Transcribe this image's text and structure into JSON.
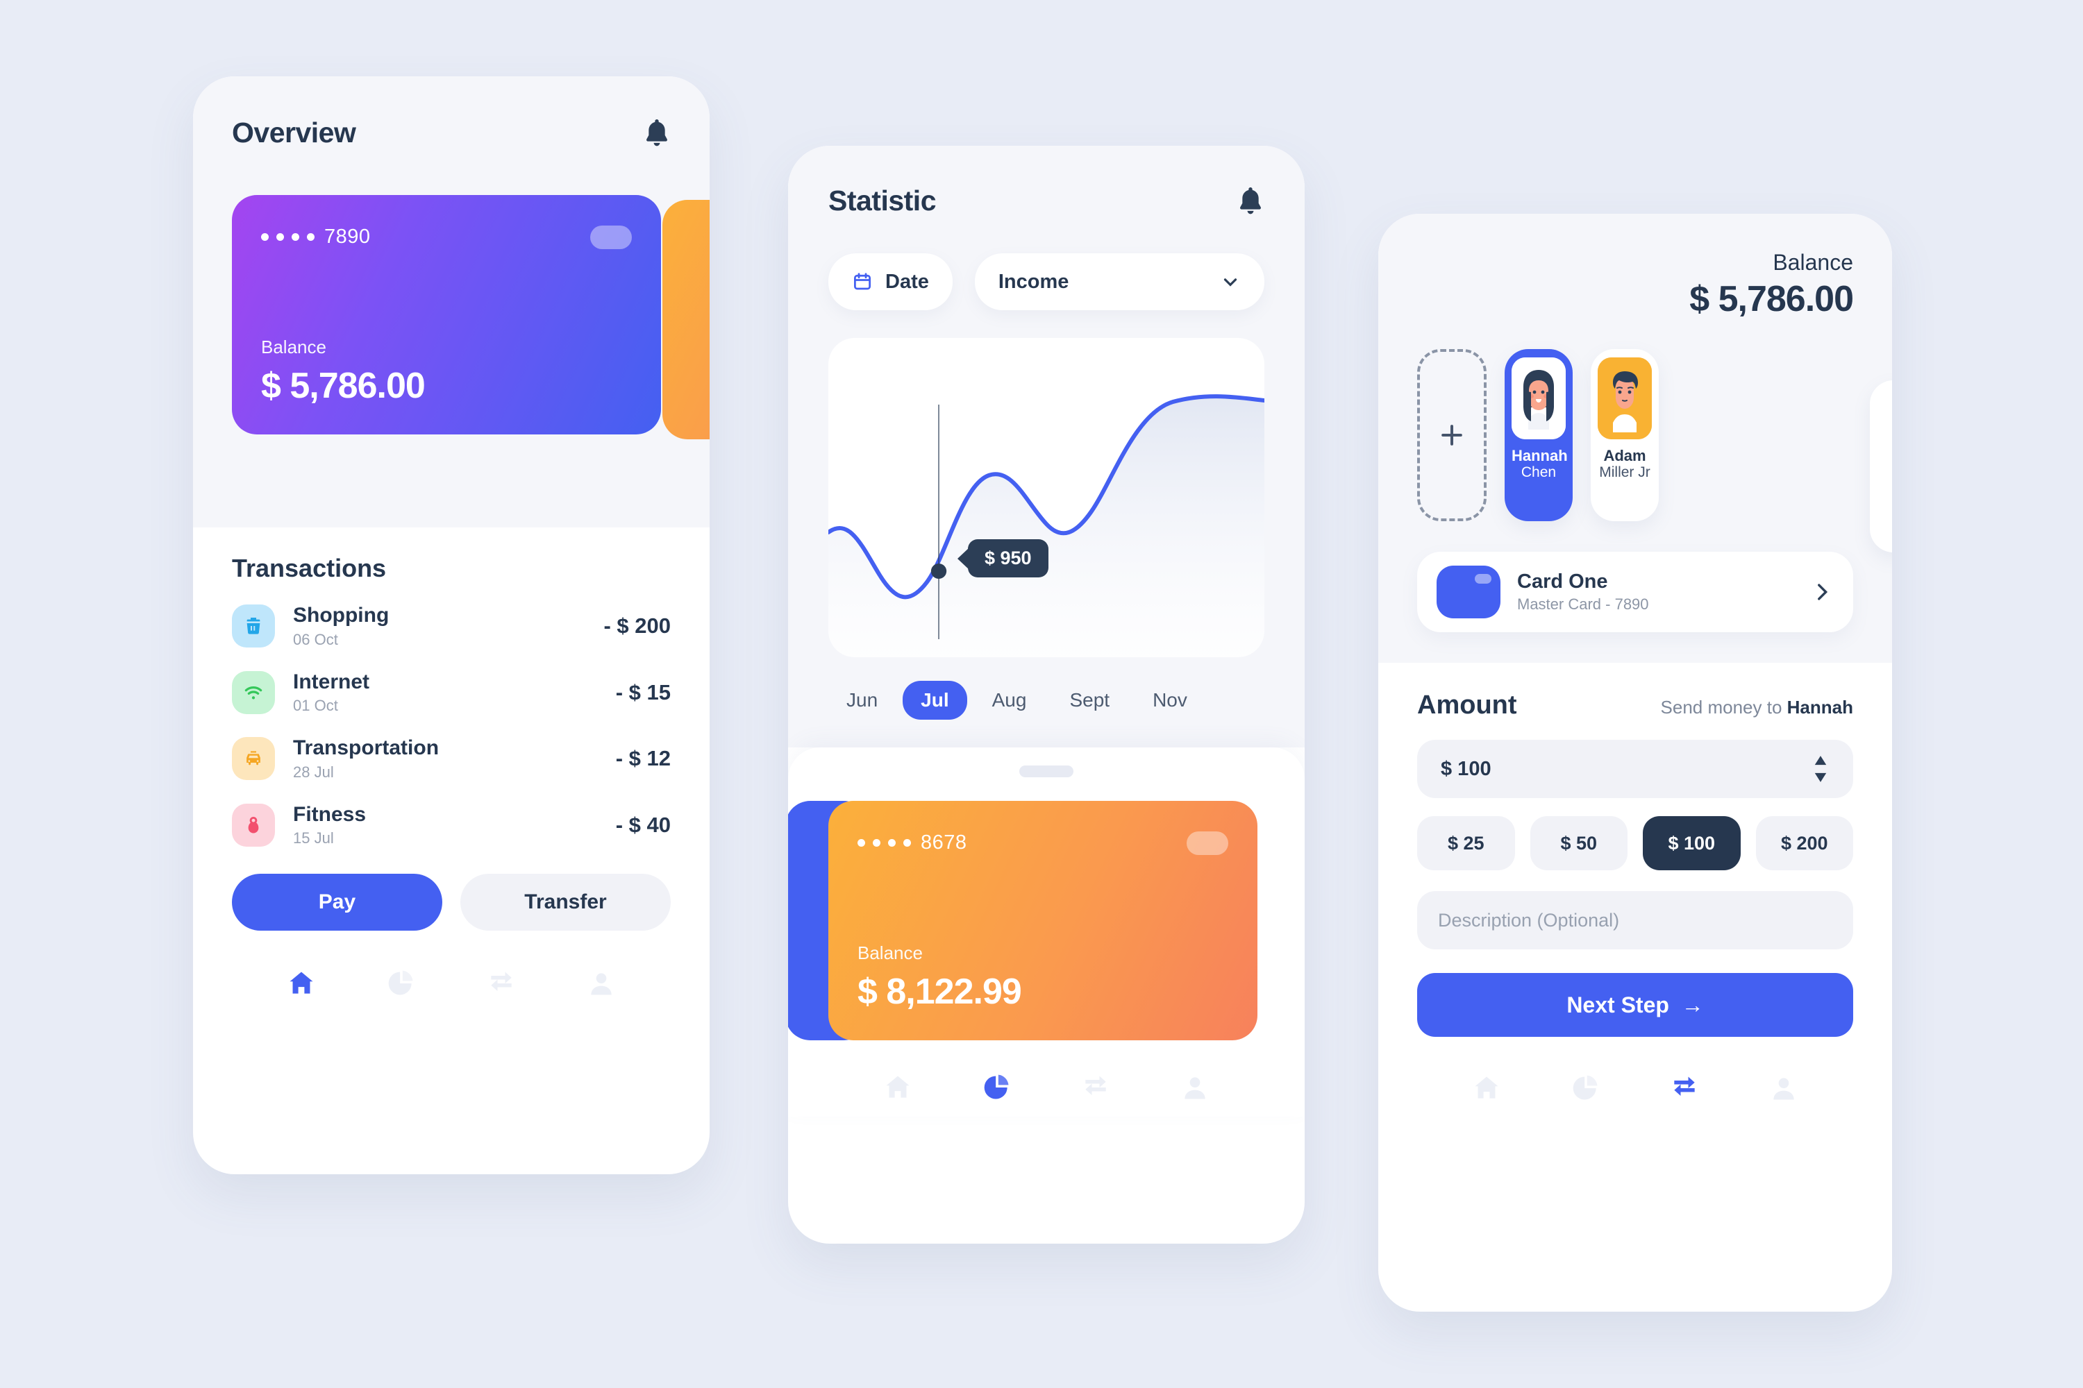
{
  "screen_overview": {
    "title": "Overview",
    "bell_icon": "bell-icon",
    "card": {
      "masked_dots": "••••",
      "last4": "7890",
      "balance_label": "Balance",
      "balance_value": "$ 5,786.00",
      "gradient_from": "#a445f0",
      "gradient_to": "#4460f1"
    },
    "peek_card_color": "#fbb03b",
    "transactions_title": "Transactions",
    "transactions": [
      {
        "name": "Shopping",
        "date": "06 Oct",
        "amount": "- $ 200",
        "icon": "basket-icon",
        "icon_bg": "#bfe6fb",
        "icon_fg": "#23a6e8"
      },
      {
        "name": "Internet",
        "date": "01 Oct",
        "amount": "- $ 15",
        "icon": "wifi-icon",
        "icon_bg": "#c6f3d4",
        "icon_fg": "#34c759"
      },
      {
        "name": "Transportation",
        "date": "28 Jul",
        "amount": "- $ 12",
        "icon": "taxi-icon",
        "icon_bg": "#fde6bc",
        "icon_fg": "#f5a623"
      },
      {
        "name": "Fitness",
        "date": "15 Jul",
        "amount": "- $ 40",
        "icon": "kettlebell-icon",
        "icon_bg": "#fcd3dc",
        "icon_fg": "#f2506e"
      }
    ],
    "pay_label": "Pay",
    "transfer_label": "Transfer",
    "nav": [
      {
        "icon": "home-icon",
        "active": true
      },
      {
        "icon": "pie-icon",
        "active": false
      },
      {
        "icon": "exchange-icon",
        "active": false
      },
      {
        "icon": "person-icon",
        "active": false
      }
    ]
  },
  "screen_statistic": {
    "title": "Statistic",
    "bell_icon": "bell-icon",
    "date_pill": {
      "label": "Date",
      "icon": "calendar-icon"
    },
    "type_select": {
      "value": "Income",
      "icon": "chevron-down-icon"
    },
    "months": [
      "Jun",
      "Jul",
      "Aug",
      "Sept",
      "Nov"
    ],
    "active_month": "Jul",
    "card": {
      "masked_dots": "••••",
      "last4": "8678",
      "balance_label": "Balance",
      "balance_value": "$ 8,122.99",
      "gradient_from": "#fbb03b",
      "gradient_to": "#f7815c"
    },
    "peek_card_color": "#4460f1",
    "nav": [
      {
        "icon": "home-icon",
        "active": false
      },
      {
        "icon": "pie-icon",
        "active": true
      },
      {
        "icon": "exchange-icon",
        "active": false
      },
      {
        "icon": "person-icon",
        "active": false
      }
    ]
  },
  "screen_transfer": {
    "balance_label": "Balance",
    "balance_value": "$ 5,786.00",
    "add_person_icon": "plus-icon",
    "people": [
      {
        "first": "Hannah",
        "last": "Chen",
        "selected": true,
        "avatar_bg": "#ffffff"
      },
      {
        "first": "Adam",
        "last": "Miller Jr",
        "selected": false,
        "avatar_bg": "#f9b233"
      }
    ],
    "card_row": {
      "name": "Card One",
      "sub": "Master Card - 7890",
      "chevron_icon": "chevron-right-icon"
    },
    "amount_title": "Amount",
    "send_prefix": "Send money to ",
    "send_name": "Hannah",
    "amount_value": "$ 100",
    "stepper_icon": "stepper-arrows-icon",
    "quick_amounts": [
      "$ 25",
      "$ 50",
      "$ 100",
      "$ 200"
    ],
    "selected_quick_amount": "$ 100",
    "description_placeholder": "Description (Optional)",
    "next_label": "Next Step",
    "next_icon": "arrow-right-icon",
    "nav": [
      {
        "icon": "home-icon",
        "active": false
      },
      {
        "icon": "pie-icon",
        "active": false
      },
      {
        "icon": "exchange-icon",
        "active": true
      },
      {
        "icon": "person-icon",
        "active": false
      }
    ]
  },
  "chart_data": {
    "type": "line",
    "title": "",
    "xlabel": "",
    "ylabel": "",
    "categories": [
      "Jun",
      "Jul",
      "Aug",
      "Sept",
      "Nov"
    ],
    "x": [
      0,
      1,
      2,
      3,
      4,
      5,
      6,
      7,
      8
    ],
    "values": [
      620,
      560,
      430,
      950,
      1180,
      980,
      900,
      1340,
      1400
    ],
    "ylim": [
      300,
      1500
    ],
    "grid": false,
    "legend": "none",
    "line_color": "#4460f1",
    "fill_color": "#eef1f8",
    "marker": {
      "x_index": 3,
      "value": 950,
      "label": "$ 950",
      "tooltip_bg": "#2c3e56"
    },
    "annotations": [
      "$ 950"
    ]
  }
}
